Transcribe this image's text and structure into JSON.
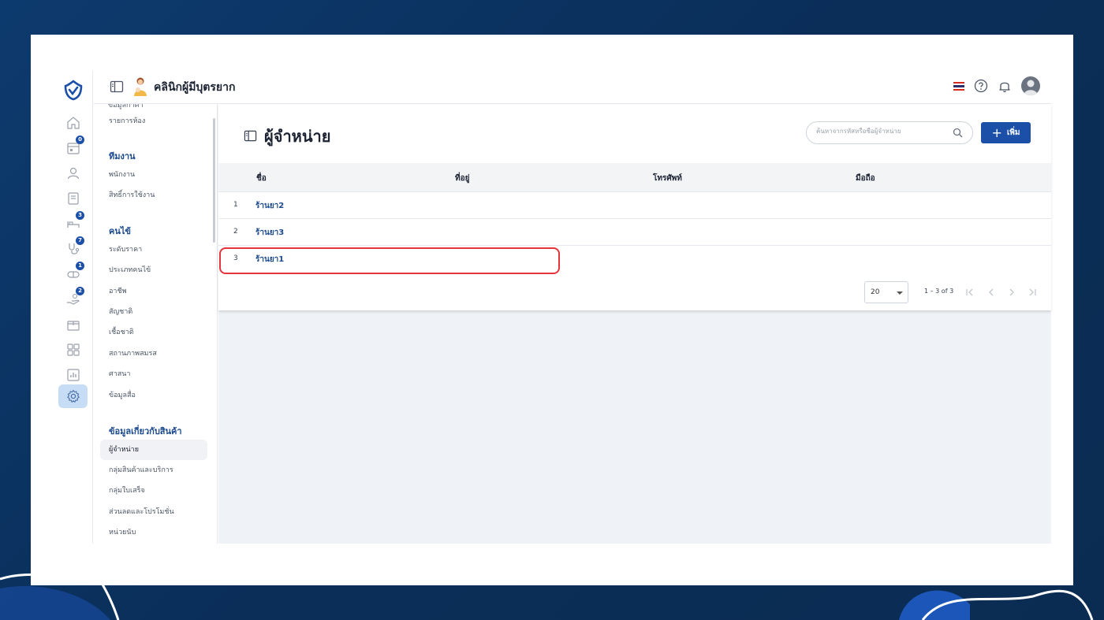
{
  "header": {
    "clinic_name": "คลินิกผู้มีบุตรยาก",
    "flag": "thai-flag"
  },
  "rail": {
    "badges": {
      "calendar": "0",
      "bed": "3",
      "stethoscope": "7",
      "pills": "1",
      "hand": "2"
    }
  },
  "menu": {
    "cut_item": "ข้อมูลกาคา",
    "item_rooms": "รายการห้อง",
    "section_team": "ทีมงาน",
    "item_staff": "พนักงาน",
    "item_permissions": "สิทธิ์การใช้งาน",
    "section_patient": "คนไข้",
    "item_price_level": "ระดับราคา",
    "item_patient_type": "ประเภทคนไข้",
    "item_occupation": "อาชีพ",
    "item_nationality": "สัญชาติ",
    "item_race": "เชื้อชาติ",
    "item_marital": "สถานภาพสมรส",
    "item_religion": "ศาสนา",
    "item_media": "ข้อมูลสื่อ",
    "section_product": "ข้อมูลเกี่ยวกับสินค้า",
    "item_supplier": "ผู้จำหน่าย",
    "item_product_group": "กลุ่มสินค้าและบริการ",
    "item_receipt_group": "กลุ่มใบเสร็จ",
    "item_discount": "ส่วนลดและโปรโมชั่น",
    "item_unit": "หน่วยนับ"
  },
  "main": {
    "title": "ผู้จำหน่าย",
    "search_placeholder": "ค้นหาจากรหัสหรือชื่อผู้จำหน่าย",
    "add_label": "เพิ่ม",
    "columns": [
      "ชื่อ",
      "ที่อยู่",
      "โทรศัพท์",
      "มือถือ"
    ],
    "rows": [
      {
        "no": "1",
        "name": "ร้านยา2"
      },
      {
        "no": "2",
        "name": "ร้านยา3"
      },
      {
        "no": "3",
        "name": "ร้านยา1"
      }
    ],
    "highlighted_row": 3,
    "page_size": "20",
    "range_text": "1 – 3 of 3"
  },
  "colors": {
    "primary": "#1b4fa8",
    "highlight": "#e5343a",
    "background": "#0d3a6e"
  }
}
